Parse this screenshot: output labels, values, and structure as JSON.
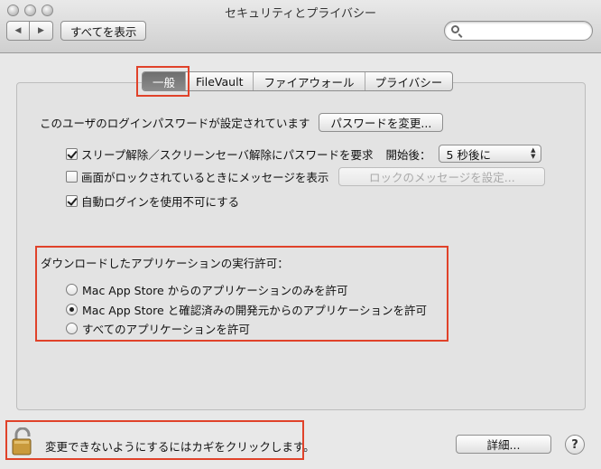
{
  "window": {
    "title": "セキュリティとプライバシー"
  },
  "toolbar": {
    "back_icon": "◀",
    "forward_icon": "▶",
    "show_all_label": "すべてを表示",
    "search_placeholder": ""
  },
  "tabs": [
    {
      "label": "一般",
      "active": true
    },
    {
      "label": "FileVault",
      "active": false
    },
    {
      "label": "ファイアウォール",
      "active": false
    },
    {
      "label": "プライバシー",
      "active": false
    }
  ],
  "general": {
    "password_text": "このユーザのログインパスワードが設定されています",
    "change_password_button": "パスワードを変更...",
    "require_password_label": "スリープ解除／スクリーンセーバ解除にパスワードを要求",
    "require_password_checked": true,
    "delay_label": "開始後：",
    "delay_value": "5 秒後に",
    "lock_message_label": "画面がロックされているときにメッセージを表示",
    "lock_message_checked": false,
    "lock_message_button": "ロックのメッセージを設定...",
    "disable_autologin_label": "自動ログインを使用不可にする",
    "disable_autologin_checked": true
  },
  "downloads": {
    "heading": "ダウンロードしたアプリケーションの実行許可：",
    "options": [
      {
        "label": "Mac App Store からのアプリケーションのみを許可",
        "selected": false
      },
      {
        "label": "Mac App Store と確認済みの開発元からのアプリケーションを許可",
        "selected": true
      },
      {
        "label": "すべてのアプリケーションを許可",
        "selected": false
      }
    ]
  },
  "footer": {
    "lock_text": "変更できないようにするにはカギをクリックします。",
    "advanced_button": "詳細...",
    "help_label": "?"
  },
  "colors": {
    "highlight": "#e0422a",
    "tab_active": "#7a7a7a"
  }
}
